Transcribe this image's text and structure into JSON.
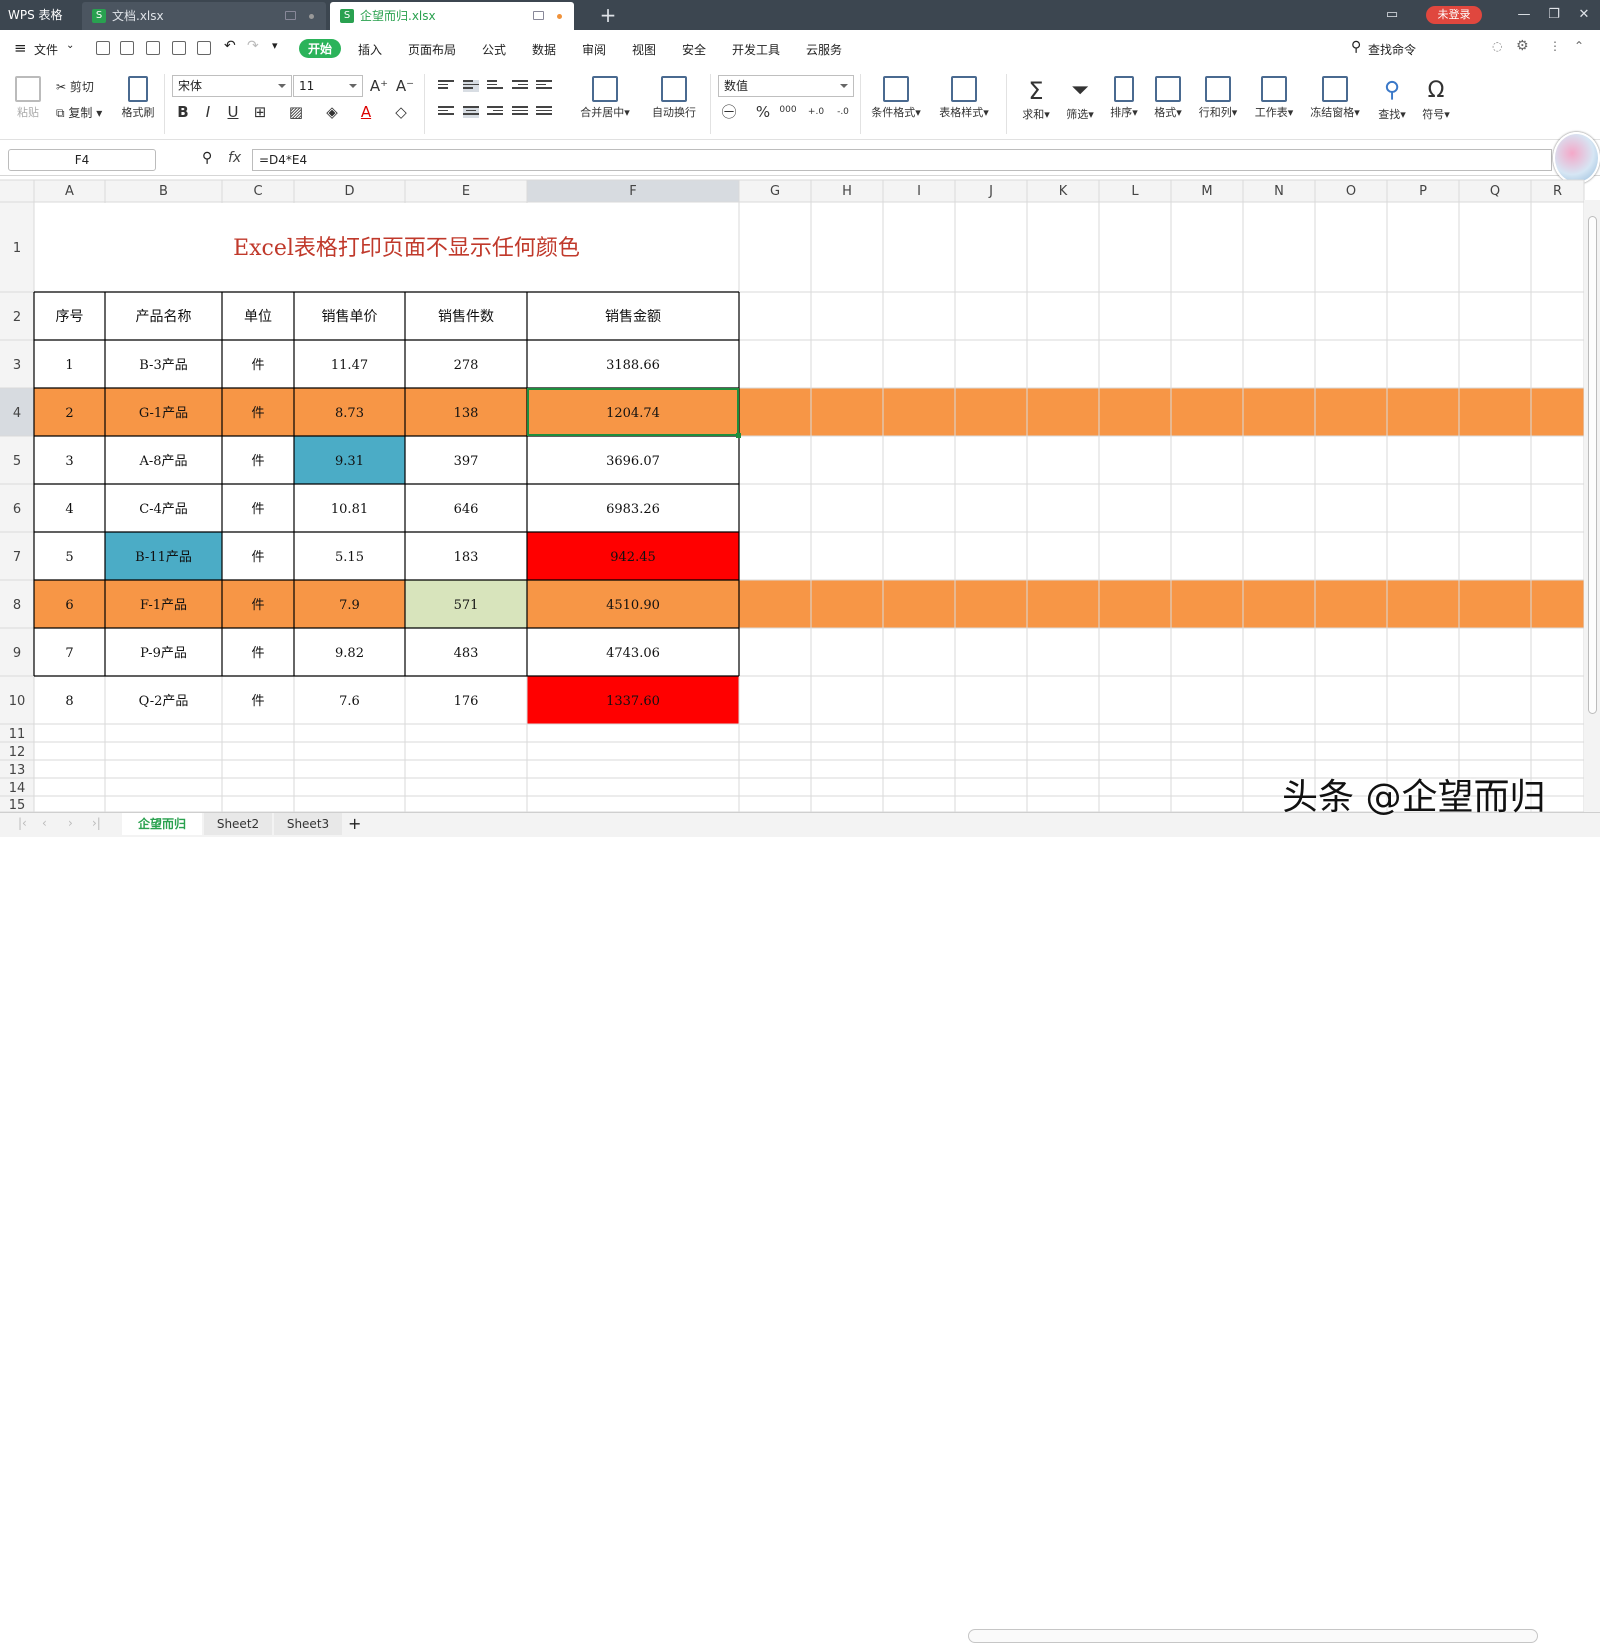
{
  "titlebar": {
    "app_name": "WPS 表格",
    "tabs": [
      {
        "label": "文档.xlsx"
      },
      {
        "label": "企望而归.xlsx"
      }
    ],
    "login": "未登录"
  },
  "menu": {
    "file": "文件",
    "items": [
      "开始",
      "插入",
      "页面布局",
      "公式",
      "数据",
      "审阅",
      "视图",
      "安全",
      "开发工具",
      "云服务"
    ],
    "search": "查找命令"
  },
  "ribbon": {
    "paste": "粘贴",
    "cut": "剪切",
    "copy": "复制",
    "format_painter": "格式刷",
    "font_name": "宋体",
    "font_size": "11",
    "merge": "合并居中",
    "wrap": "自动换行",
    "number_format": "数值",
    "cond_format": "条件格式",
    "table_style": "表格样式",
    "sum": "求和",
    "filter": "筛选",
    "sort": "排序",
    "format": "格式",
    "rowcol": "行和列",
    "worksheet": "工作表",
    "freeze": "冻结窗格",
    "find": "查找",
    "symbol": "符号",
    "percent": "%",
    "thousand": "000",
    "dec_inc": "+.0",
    "dec_dec": "-.0"
  },
  "formula_bar": {
    "cell_ref": "F4",
    "fx": "fx",
    "formula": "=D4*E4"
  },
  "sheet": {
    "col_headers": [
      "A",
      "B",
      "C",
      "D",
      "E",
      "F",
      "G",
      "H",
      "I",
      "J",
      "K",
      "L",
      "M",
      "N",
      "O",
      "P",
      "Q",
      "R"
    ],
    "row_numbers": [
      "1",
      "2",
      "3",
      "4",
      "5",
      "6",
      "7",
      "8",
      "9",
      "10",
      "11",
      "12",
      "13",
      "14",
      "15"
    ],
    "title": "Excel表格打印页面不显示任何颜色",
    "headers": [
      "序号",
      "产品名称",
      "单位",
      "销售单价",
      "销售件数",
      "销售金额"
    ],
    "rows": [
      [
        "1",
        "B-3产品",
        "件",
        "11.47",
        "278",
        "3188.66"
      ],
      [
        "2",
        "G-1产品",
        "件",
        "8.73",
        "138",
        "1204.74"
      ],
      [
        "3",
        "A-8产品",
        "件",
        "9.31",
        "397",
        "3696.07"
      ],
      [
        "4",
        "C-4产品",
        "件",
        "10.81",
        "646",
        "6983.26"
      ],
      [
        "5",
        "B-11产品",
        "件",
        "5.15",
        "183",
        "942.45"
      ],
      [
        "6",
        "F-1产品",
        "件",
        "7.9",
        "571",
        "4510.90"
      ],
      [
        "7",
        "P-9产品",
        "件",
        "9.82",
        "483",
        "4743.06"
      ],
      [
        "8",
        "Q-2产品",
        "件",
        "7.6",
        "176",
        "1337.60"
      ]
    ],
    "colors": {
      "orange": "#f79646",
      "blue": "#4bacc6",
      "red": "#ff0000",
      "lightgreen": "#d8e4bc",
      "title": "#c0392b"
    },
    "active_cell": "F4"
  },
  "sheet_tabs": [
    "企望而归",
    "Sheet2",
    "Sheet3"
  ],
  "watermark": "头条 @企望而归"
}
